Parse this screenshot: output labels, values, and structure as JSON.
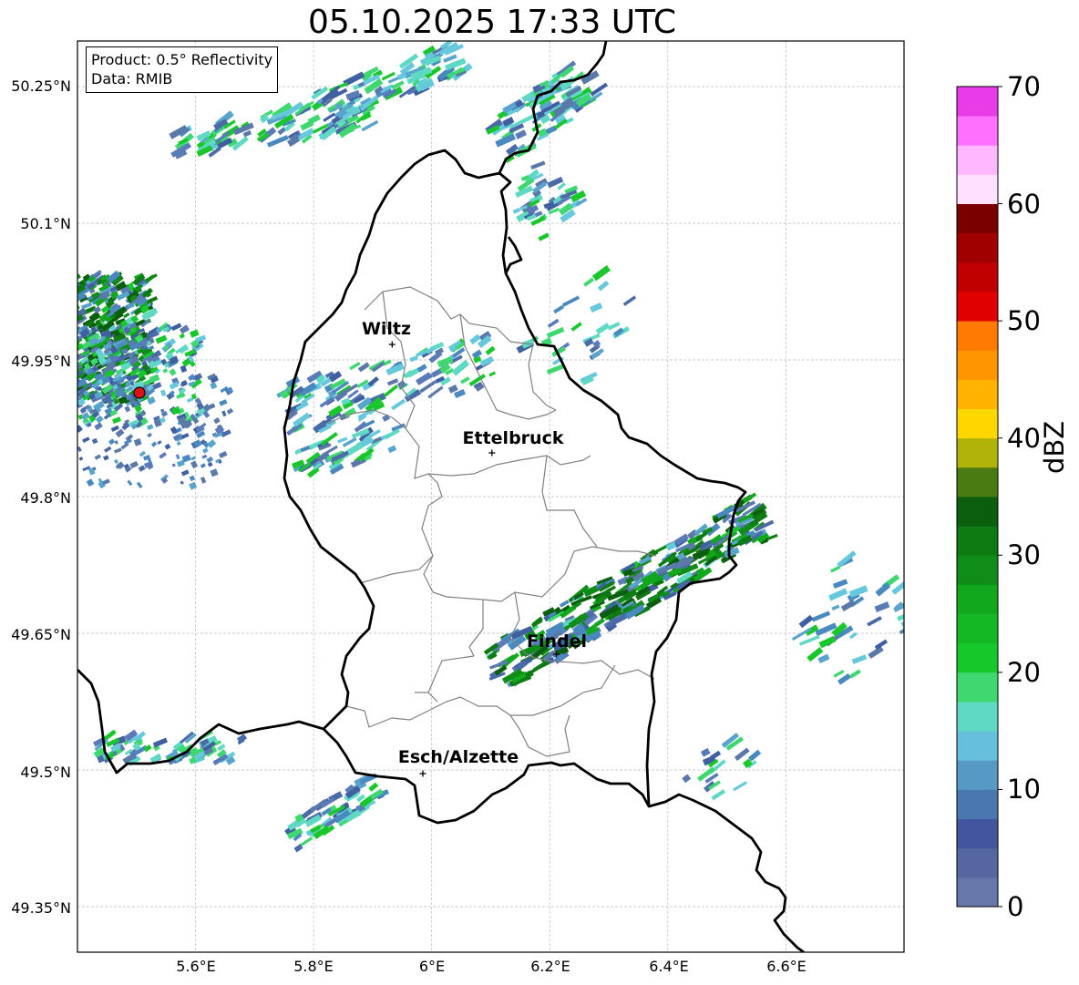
{
  "title": "05.10.2025 17:33 UTC",
  "info": {
    "product": "Product: 0.5° Reflectivity",
    "data": "Data: RMIB"
  },
  "axes": {
    "lat_labels": [
      "50.25°N",
      "50.1°N",
      "49.95°N",
      "49.8°N",
      "49.65°N",
      "49.5°N",
      "49.35°N"
    ],
    "lon_labels": [
      "5.6°E",
      "5.8°E",
      "6°E",
      "6.2°E",
      "6.4°E",
      "6.6°E"
    ]
  },
  "places": [
    {
      "name": "Wiltz",
      "lon": 5.933,
      "lat": 49.967
    },
    {
      "name": "Ettelbruck",
      "lon": 6.102,
      "lat": 49.848
    },
    {
      "name": "Findel",
      "lon": 6.211,
      "lat": 49.627
    },
    {
      "name": "Esch/Alzette",
      "lon": 5.985,
      "lat": 49.496
    }
  ],
  "radar_site": {
    "name": "radar-site-marker",
    "lon": 5.505,
    "lat": 49.914,
    "color": "#e01010"
  },
  "colorbar": {
    "label": "dBZ",
    "ticks": [
      "0",
      "10",
      "20",
      "30",
      "40",
      "50",
      "60",
      "70"
    ],
    "min": 0,
    "max": 70,
    "step": 2.5,
    "colors": [
      "#6677aa",
      "#5566a0",
      "#4455a0",
      "#4a77b0",
      "#5599c4",
      "#66c0dd",
      "#5fd8c4",
      "#3fd870",
      "#16c82a",
      "#14b824",
      "#12a81e",
      "#108c18",
      "#0e7a12",
      "#0a5e0e",
      "#4a7a12",
      "#b0b40a",
      "#ffd700",
      "#ffb300",
      "#ff9600",
      "#ff7a00",
      "#e00000",
      "#c00000",
      "#a00000",
      "#7a0000",
      "#ffe0ff",
      "#ffb8ff",
      "#ff70ff",
      "#e83ce8"
    ]
  },
  "map_extent": {
    "lon_min": 5.4,
    "lon_max": 6.8,
    "lat_min": 49.3,
    "lat_max": 50.3
  }
}
